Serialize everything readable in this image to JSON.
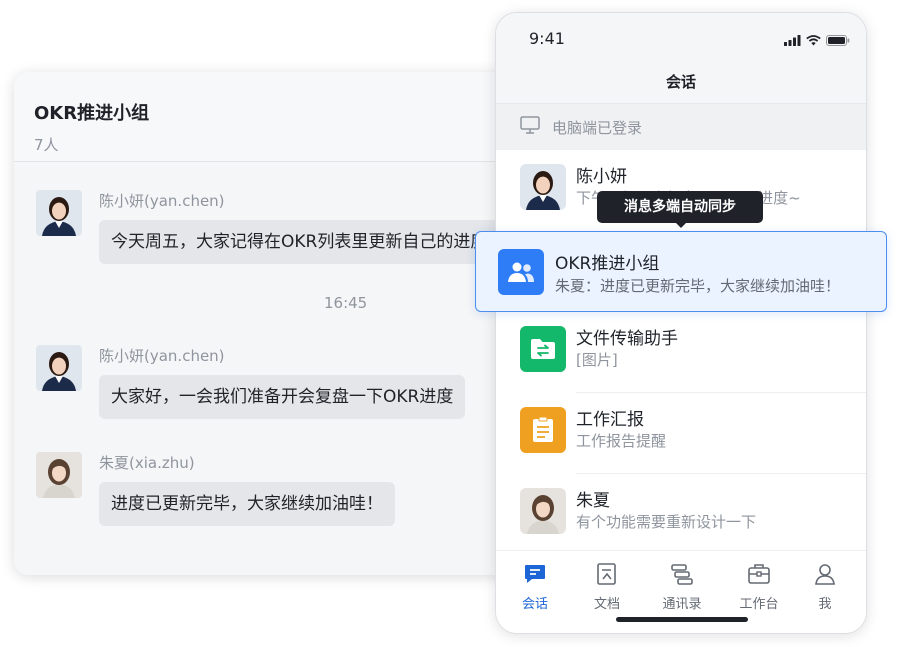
{
  "desktop_chat": {
    "title": "OKR推进小组",
    "member_count": "7人",
    "messages": [
      {
        "sender": "陈小妍(yan.chen)",
        "text": "今天周五，大家记得在OKR列表里更新自己的进度"
      },
      {
        "sender": "陈小妍(yan.chen)",
        "text": "大家好，一会我们准备开会复盘一下OKR进度"
      },
      {
        "sender": "朱夏(xia.zhu)",
        "text": "进度已更新完毕，大家继续加油哇！"
      }
    ],
    "timestamp": "16:45"
  },
  "phone": {
    "status": {
      "time": "9:41",
      "icons": [
        "signal-icon",
        "wifi-icon",
        "battery-icon"
      ]
    },
    "nav_title": "会话",
    "pc_login_banner": "电脑端已登录",
    "conversations": [
      {
        "name": "陈小妍",
        "preview": "下午一起开会复盘一下OKR进度~",
        "icon": "avatar"
      },
      {
        "name": "OKR推进小组",
        "preview": "朱夏：进度已更新完毕，大家继续加油哇！",
        "icon": "group-icon"
      },
      {
        "name": "文件传输助手",
        "preview": "[图片]",
        "icon": "file-transfer-icon"
      },
      {
        "name": "工作汇报",
        "preview": "工作报告提醒",
        "icon": "report-icon"
      },
      {
        "name": "朱夏",
        "preview": "有个功能需要重新设计一下",
        "icon": "avatar"
      }
    ],
    "tabs": [
      {
        "label": "会话",
        "icon": "chat-icon",
        "active": true
      },
      {
        "label": "文档",
        "icon": "doc-icon",
        "active": false
      },
      {
        "label": "通讯录",
        "icon": "contacts-icon",
        "active": false
      },
      {
        "label": "工作台",
        "icon": "briefcase-icon",
        "active": false
      },
      {
        "label": "我",
        "icon": "person-icon",
        "active": false
      }
    ]
  },
  "tooltip": "消息多端自动同步",
  "colors": {
    "accent": "#1e66d6",
    "highlight_bg": "#eaf3ff",
    "highlight_border": "#4c8df0",
    "file_transfer": "#14b86a",
    "report": "#f0a020",
    "bubble": "#e4e6e9"
  }
}
